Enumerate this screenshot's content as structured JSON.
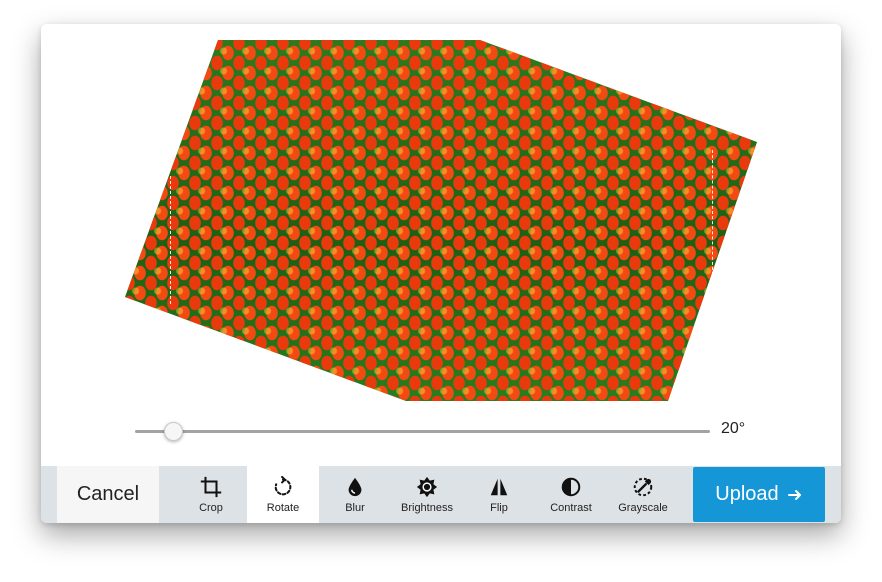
{
  "editor": {
    "rotation": {
      "angle_label": "20°",
      "value_deg": 20
    }
  },
  "toolbar": {
    "cancel_label": "Cancel",
    "tools": [
      {
        "id": "crop",
        "label": "Crop",
        "icon": "crop-icon"
      },
      {
        "id": "rotate",
        "label": "Rotate",
        "icon": "rotate-icon",
        "active": true
      },
      {
        "id": "blur",
        "label": "Blur",
        "icon": "droplet-icon"
      },
      {
        "id": "brightness",
        "label": "Brightness",
        "icon": "sun-icon"
      },
      {
        "id": "flip",
        "label": "Flip",
        "icon": "flip-icon"
      },
      {
        "id": "contrast",
        "label": "Contrast",
        "icon": "contrast-icon"
      },
      {
        "id": "grayscale",
        "label": "Grayscale",
        "icon": "grayscale-icon"
      }
    ],
    "upload_label": "Upload"
  },
  "colors": {
    "toolbar_bg": "#dde2e6",
    "upload_bg": "#1596d6",
    "active_tool_bg": "#ffffff"
  }
}
